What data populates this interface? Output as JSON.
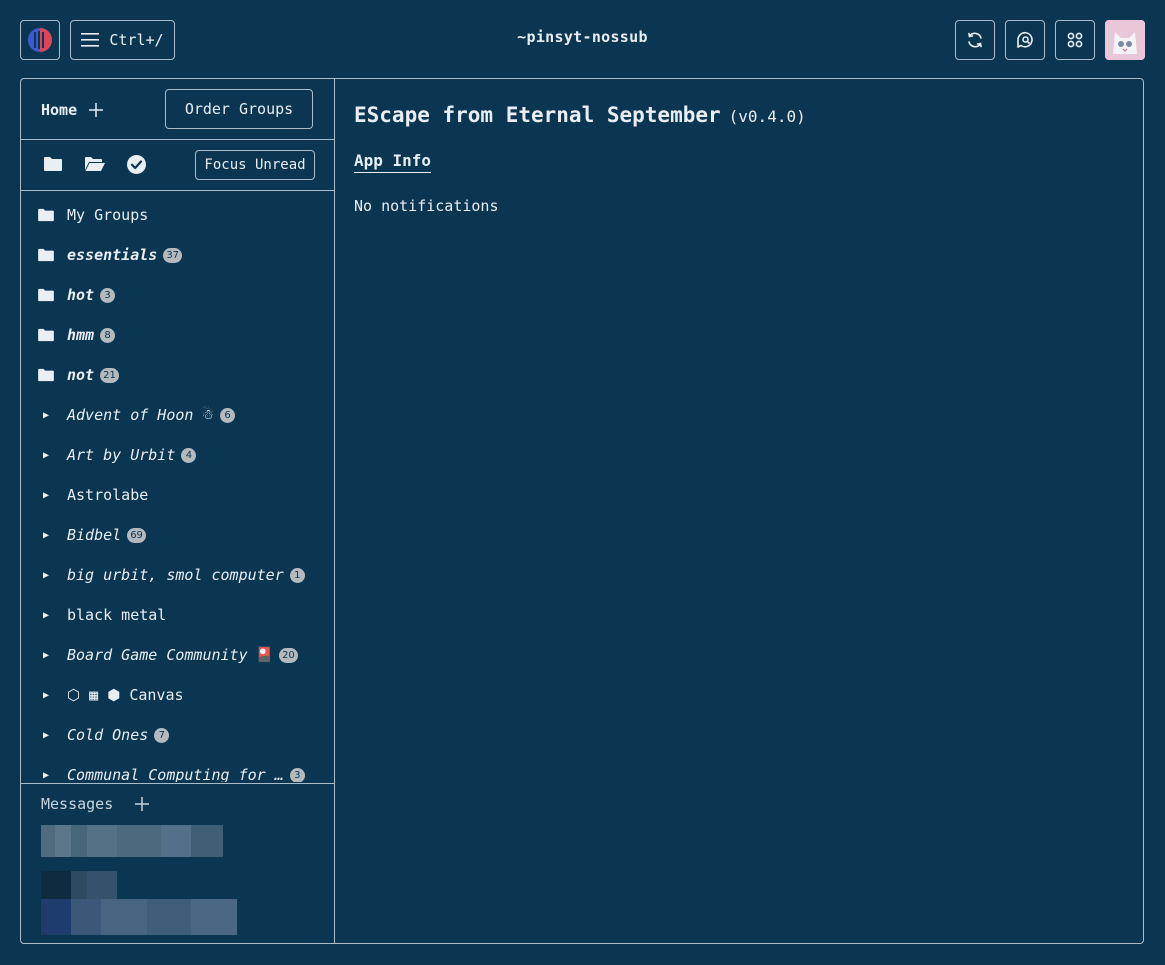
{
  "header": {
    "title": "~pinsyt-nossub",
    "shortcut_label": "Ctrl+/",
    "logo_icon": "leap-logo-icon",
    "menu_icon": "hamburger-menu-icon",
    "refresh_icon": "refresh-icon",
    "notifications_icon": "chat-search-icon",
    "apps_icon": "apps-grid-icon",
    "avatar_icon": "cat-avatar-icon"
  },
  "sidebar": {
    "home_label": "Home",
    "add_icon": "plus-icon",
    "order_groups_label": "Order Groups",
    "focus_unread_label": "Focus Unread",
    "filter_icons": [
      "folder-icon",
      "folder-open-icon",
      "check-circle-icon"
    ],
    "groups": [
      {
        "name": "My Groups",
        "badge": "",
        "style": "normal",
        "kind": "folder"
      },
      {
        "name": "essentials",
        "badge": "37",
        "style": "bolditalic",
        "kind": "folder"
      },
      {
        "name": "hot",
        "badge": "3",
        "style": "bolditalic",
        "kind": "folder"
      },
      {
        "name": "hmm",
        "badge": "8",
        "style": "bolditalic",
        "kind": "folder"
      },
      {
        "name": "not",
        "badge": "21",
        "style": "bolditalic",
        "kind": "folder"
      },
      {
        "name": "Advent of Hoon",
        "badge": "6",
        "style": "italic",
        "kind": "group",
        "emoji": "☃"
      },
      {
        "name": "Art by Urbit",
        "badge": "4",
        "style": "italic",
        "kind": "group"
      },
      {
        "name": "Astrolabe",
        "badge": "",
        "style": "normal",
        "kind": "group"
      },
      {
        "name": "Bidbel",
        "badge": "69",
        "style": "italic",
        "kind": "group"
      },
      {
        "name": "big urbit, smol computer",
        "badge": "1",
        "style": "italic",
        "kind": "group"
      },
      {
        "name": "black metal",
        "badge": "",
        "style": "normal",
        "kind": "group"
      },
      {
        "name": "Board Game Community",
        "badge": "20",
        "style": "italic",
        "kind": "group",
        "emoji": "🎴"
      },
      {
        "name": "⬡ ▦ ⬢ Canvas",
        "badge": "",
        "style": "normal",
        "kind": "group"
      },
      {
        "name": "Cold Ones",
        "badge": "7",
        "style": "italic",
        "kind": "group"
      },
      {
        "name": "Communal Computing for …",
        "badge": "3",
        "style": "italic",
        "kind": "group"
      }
    ],
    "messages_label": "Messages",
    "messages_add_icon": "plus-icon"
  },
  "main": {
    "title": "EScape from Eternal September",
    "version": "(v0.4.0)",
    "tab_app_info": "App Info",
    "empty_text": "No notifications"
  },
  "colors": {
    "background": "#0b3652",
    "border": "#a9bcc9",
    "text": "#e8eef3",
    "badge": "#b3b9bd"
  }
}
